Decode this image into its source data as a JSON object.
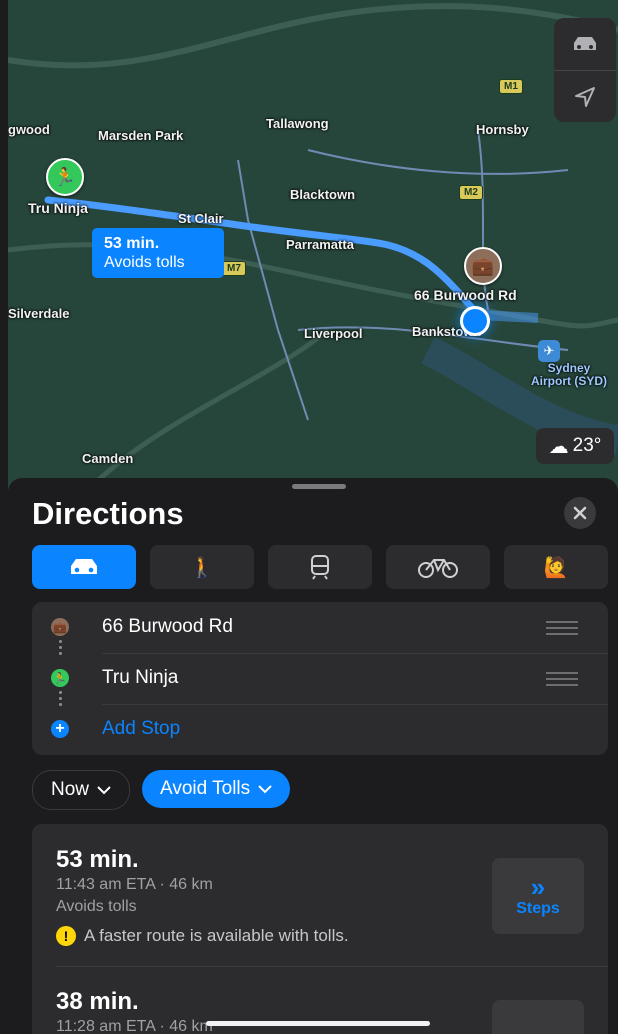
{
  "map": {
    "places": {
      "wood": "gwood",
      "marsden": "Marsden Park",
      "tallawong": "Tallawong",
      "hornsby": "Hornsby",
      "blacktown": "Blacktown",
      "stclair": "St Clair",
      "parramatta": "Parramatta",
      "silverdale": "Silverdale",
      "liverpool": "Liverpool",
      "bankstown": "Bankstown",
      "camden": "Camden",
      "airport_line1": "Sydney",
      "airport_line2": "Airport (SYD)"
    },
    "roads": {
      "m1": "M1",
      "m2": "M2",
      "m7": "M7"
    },
    "origin_label": "Tru Ninja",
    "destination_label": "66 Burwood Rd",
    "route_callout": {
      "time": "53 min.",
      "note": "Avoids tolls"
    },
    "weather": "23°"
  },
  "directions": {
    "title": "Directions",
    "modes": [
      "drive",
      "walk",
      "transit",
      "cycle",
      "rideshare"
    ],
    "stops": [
      "66 Burwood Rd",
      "Tru Ninja"
    ],
    "add_stop": "Add Stop",
    "time_option": "Now",
    "avoid_option": "Avoid Tolls",
    "routes": [
      {
        "time": "53 min.",
        "eta": "11:43 am ETA · 46 km",
        "note": "Avoids tolls",
        "warning": "A faster route is available with tolls.",
        "button": "Steps"
      },
      {
        "time": "38 min.",
        "eta": "11:28 am ETA · 46 km"
      }
    ]
  },
  "colors": {
    "accent": "#0a84ff",
    "map_green": "#27463b",
    "sheet": "#1c1c1e"
  }
}
